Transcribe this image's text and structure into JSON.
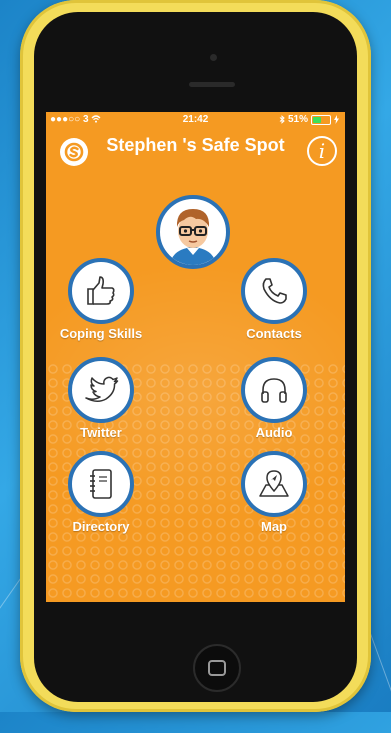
{
  "status_bar": {
    "carrier": "●●●○○ 3",
    "time": "21:42",
    "battery": "51%",
    "battery_level": 0.51
  },
  "header": {
    "title": "Stephen 's Safe Spot",
    "info_label": "i"
  },
  "tiles": [
    {
      "label": "Coping Skills",
      "icon": "thumbs-up-icon"
    },
    {
      "label": "Contacts",
      "icon": "phone-icon"
    },
    {
      "label": "Twitter",
      "icon": "twitter-bird-icon"
    },
    {
      "label": "Audio",
      "icon": "headphones-icon"
    },
    {
      "label": "Directory",
      "icon": "notebook-icon"
    },
    {
      "label": "Map",
      "icon": "map-pin-icon"
    }
  ],
  "colors": {
    "screen_bg": "#f59a22",
    "circle_border": "#2b72b5",
    "phone_case": "#f3dc5a",
    "battery_green": "#3ee05a"
  }
}
